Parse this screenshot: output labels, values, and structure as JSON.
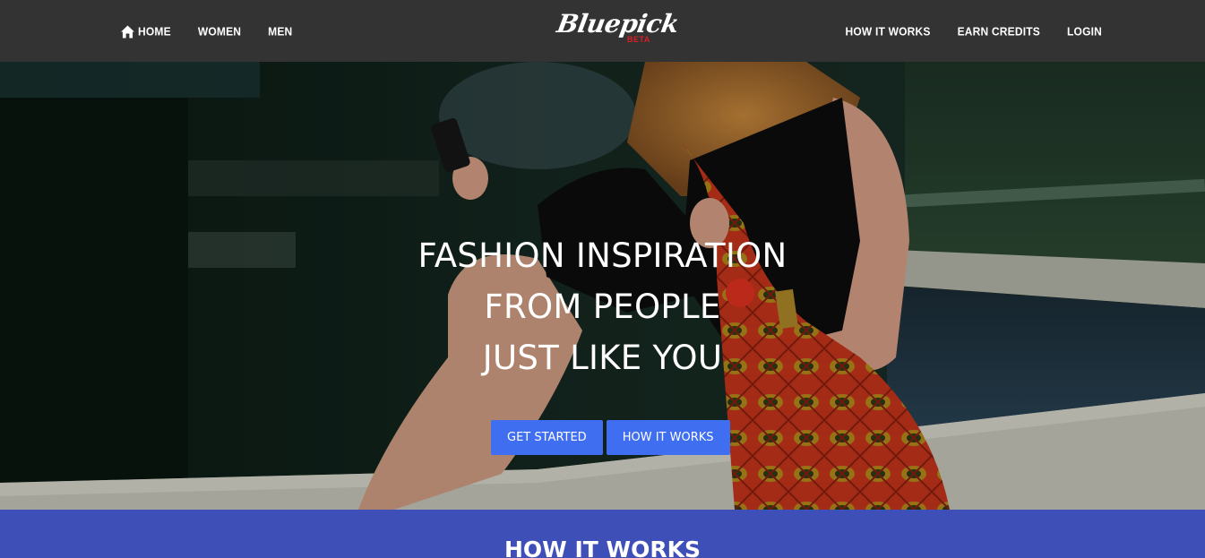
{
  "nav": {
    "left": [
      {
        "label": "HOME",
        "icon": "home-icon"
      },
      {
        "label": "WOMEN"
      },
      {
        "label": "MEN"
      }
    ],
    "right": [
      {
        "label": "HOW IT WORKS"
      },
      {
        "label": "EARN CREDITS"
      },
      {
        "label": "LOGIN"
      }
    ]
  },
  "logo": {
    "main": "Bluepick",
    "sub": "BETA",
    "sub_color": "#d81f26"
  },
  "hero": {
    "title_lines": [
      "FASHION INSPIRATION",
      "FROM PEOPLE",
      "JUST LIKE YOU"
    ],
    "buttons": {
      "get_started": "GET STARTED",
      "how_it_works": "HOW IT WORKS"
    },
    "button_color": "#3f6ff0"
  },
  "how_section": {
    "title": "HOW IT WORKS",
    "background": "#3f4fb8"
  },
  "colors": {
    "navbar": "#333333"
  }
}
